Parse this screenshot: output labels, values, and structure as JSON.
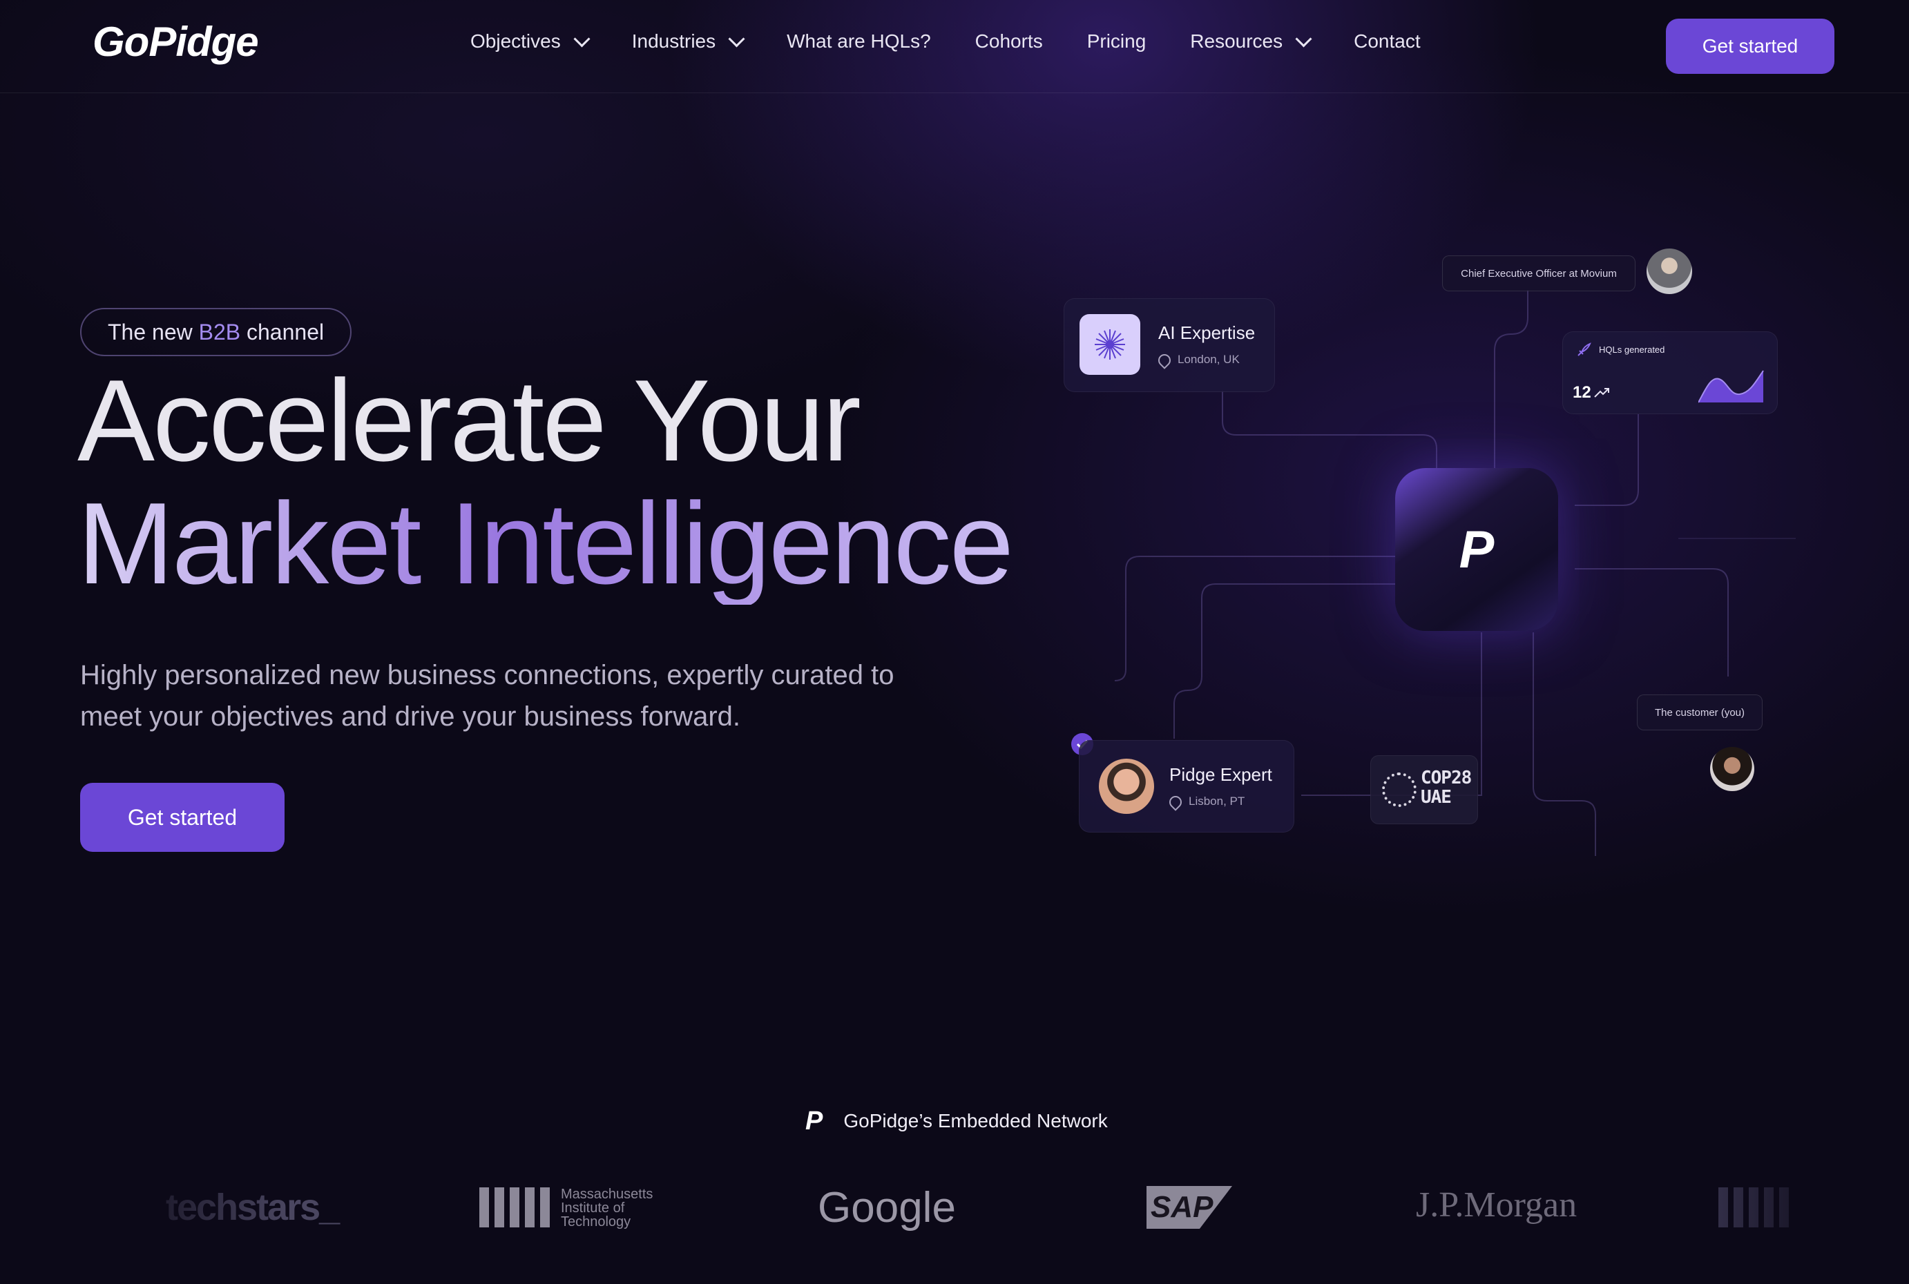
{
  "brand": {
    "name": "GoPidge"
  },
  "nav": {
    "items": [
      {
        "label": "Objectives",
        "has_dropdown": true
      },
      {
        "label": "Industries",
        "has_dropdown": true
      },
      {
        "label": "What are HQLs?",
        "has_dropdown": false
      },
      {
        "label": "Cohorts",
        "has_dropdown": false
      },
      {
        "label": "Pricing",
        "has_dropdown": false
      },
      {
        "label": "Resources",
        "has_dropdown": true
      },
      {
        "label": "Contact",
        "has_dropdown": false
      }
    ],
    "cta_label": "Get started"
  },
  "hero": {
    "tag_pre": "The new",
    "tag_highlight": "B2B",
    "tag_post": "channel",
    "headline_line1": "Accelerate Your",
    "headline_line2": "Market Intelligence",
    "subtitle": "Highly personalized new business connections, expertly curated to meet your objectives and drive your business forward.",
    "cta_label": "Get started"
  },
  "diagram": {
    "ai_card": {
      "title": "AI Expertise",
      "location": "London, UK"
    },
    "ceo_pill": "Chief Executive Officer at Movium",
    "hql_card": {
      "label": "HQLs generated",
      "value": "12"
    },
    "center_mark": "P",
    "pidge_card": {
      "title": "Pidge Expert",
      "location": "Lisbon, PT"
    },
    "cop_badge": {
      "line1": "COP28",
      "line2": "UAE"
    },
    "customer_pill": "The customer (you)"
  },
  "network": {
    "title": "GoPidge’s Embedded Network",
    "logos": [
      "techstars_",
      "Massachusetts Institute of Technology",
      "Google",
      "SAP",
      "J.P.Morgan"
    ]
  },
  "colors": {
    "accent": "#6b47d6",
    "background": "#0c0918",
    "highlight": "#a48cf0"
  },
  "icons": [
    "chevron-down-icon",
    "location-pin-icon",
    "rocket-icon",
    "trend-up-icon",
    "check-icon",
    "logo-mark-icon"
  ]
}
